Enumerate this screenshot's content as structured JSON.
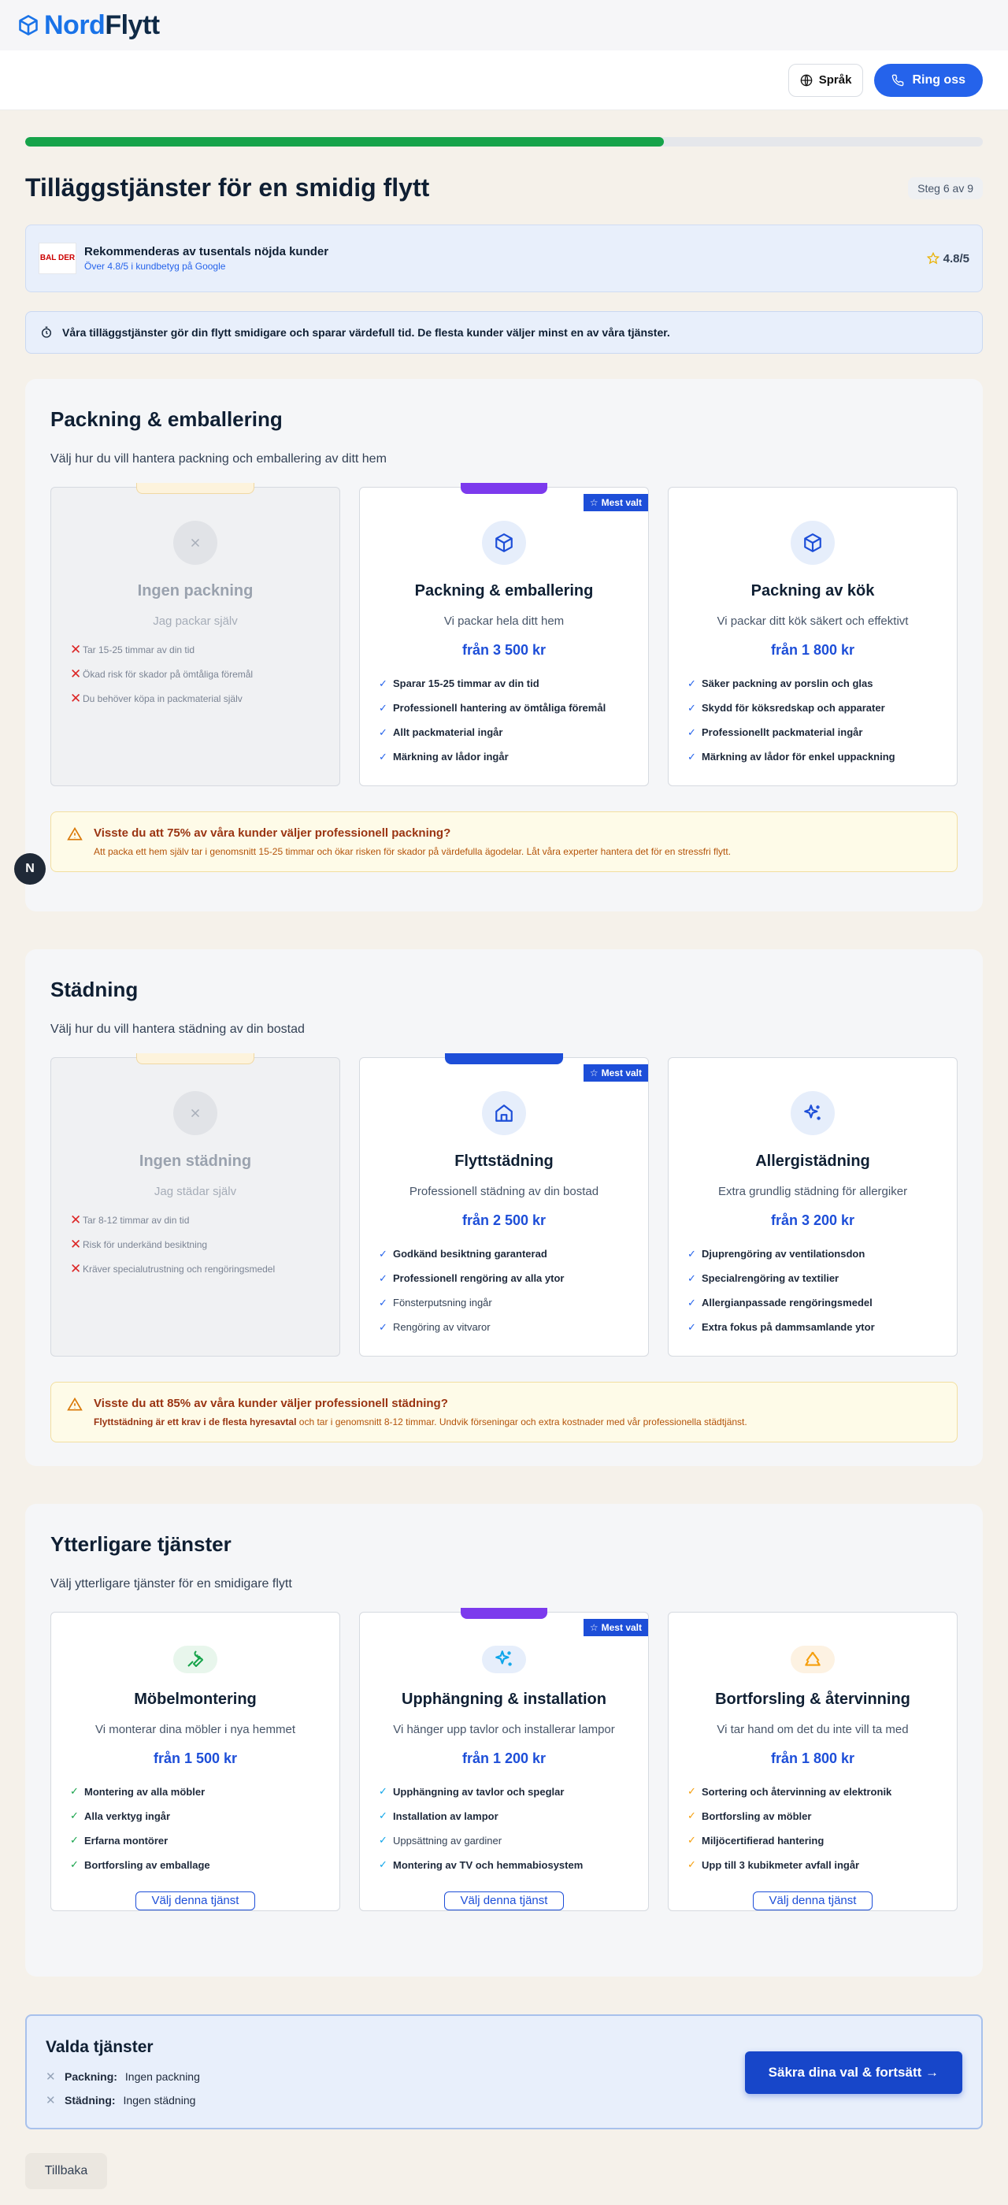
{
  "brand": {
    "nord": "Nord",
    "flytt": "Flytt"
  },
  "header": {
    "language_label": "Språk",
    "call_label": "Ring oss"
  },
  "progress": {
    "fraction": 0.667
  },
  "page": {
    "title": "Tilläggstjänster för en smidig flytt",
    "step": "Steg 6 av 9"
  },
  "recommend": {
    "logo_text": "BAL DER",
    "title": "Rekommenderas av tusentals nöjda kunder",
    "subtitle": "Över 4.8/5 i kundbetyg på Google",
    "rating": "4.8/5"
  },
  "info_text": "Våra tilläggstjänster gör din flytt smidigare och sparar värdefull tid. De flesta kunder väljer minst en av våra tjänster.",
  "mest_label": "Mest valt",
  "packing": {
    "title": "Packning & emballering",
    "subtitle": "Välj hur du vill hantera packning och emballering av ditt hem",
    "none": {
      "title": "Ingen packning",
      "desc": "Jag packar själv",
      "cons": [
        "Tar 15-25 timmar av din tid",
        "Ökad risk för skador på ömtåliga föremål",
        "Du behöver köpa in packmaterial själv"
      ]
    },
    "full": {
      "title": "Packning & emballering",
      "desc": "Vi packar hela ditt hem",
      "price": "från 3 500 kr",
      "features": [
        "Sparar 15-25 timmar av din tid",
        "Professionell hantering av ömtåliga föremål",
        "Allt packmaterial ingår",
        "Märkning av lådor ingår"
      ]
    },
    "kitchen": {
      "title": "Packning av kök",
      "desc": "Vi packar ditt kök säkert och effektivt",
      "price": "från 1 800 kr",
      "features": [
        "Säker packning av porslin och glas",
        "Skydd för köksredskap och apparater",
        "Professionellt packmaterial ingår",
        "Märkning av lådor för enkel uppackning"
      ]
    },
    "tip_title": "Visste du att 75% av våra kunder väljer professionell packning?",
    "tip_text": "Att packa ett hem själv tar i genomsnitt 15-25 timmar och ökar risken för skador på värdefulla ägodelar. Låt våra experter hantera det för en stressfri flytt."
  },
  "cleaning": {
    "title": "Städning",
    "subtitle": "Välj hur du vill hantera städning av din bostad",
    "none": {
      "title": "Ingen städning",
      "desc": "Jag städar själv",
      "cons": [
        "Tar 8-12 timmar av din tid",
        "Risk för underkänd besiktning",
        "Kräver specialutrustning och rengöringsmedel"
      ]
    },
    "move": {
      "title": "Flyttstädning",
      "desc": "Professionell städning av din bostad",
      "price": "från 2 500 kr",
      "features": [
        "Godkänd besiktning garanterad",
        "Professionell rengöring av alla ytor",
        "Fönsterputsning ingår",
        "Rengöring av vitvaror"
      ]
    },
    "allergy": {
      "title": "Allergistädning",
      "desc": "Extra grundlig städning för allergiker",
      "price": "från 3 200 kr",
      "features": [
        "Djuprengöring av ventilationsdon",
        "Specialrengöring av textilier",
        "Allergianpassade rengöringsmedel",
        "Extra fokus på dammsamlande ytor"
      ]
    },
    "tip_title": "Visste du att 85% av våra kunder väljer professionell städning?",
    "tip_bold": "Flyttstädning är ett krav i de flesta hyresavtal",
    "tip_text": " och tar i genomsnitt 8-12 timmar. Undvik förseningar och extra kostnader med vår professionella städtjänst."
  },
  "extra": {
    "title": "Ytterligare tjänster",
    "subtitle": "Välj ytterligare tjänster för en smidigare flytt",
    "choose_label": "Välj denna tjänst",
    "furniture": {
      "title": "Möbelmontering",
      "desc": "Vi monterar dina möbler i nya hemmet",
      "price": "från 1 500 kr",
      "features": [
        "Montering av alla möbler",
        "Alla verktyg ingår",
        "Erfarna montörer",
        "Bortforsling av emballage"
      ]
    },
    "install": {
      "title": "Upphängning & installation",
      "desc": "Vi hänger upp tavlor och installerar lampor",
      "price": "från 1 200 kr",
      "features": [
        "Upphängning av tavlor och speglar",
        "Installation av lampor",
        "Uppsättning av gardiner",
        "Montering av TV och hemmabiosystem"
      ]
    },
    "removal": {
      "title": "Bortforsling & återvinning",
      "desc": "Vi tar hand om det du inte vill ta med",
      "price": "från 1 800 kr",
      "features": [
        "Sortering och återvinning av elektronik",
        "Bortforsling av möbler",
        "Miljöcertifierad hantering",
        "Upp till 3 kubikmeter avfall ingår"
      ]
    }
  },
  "selected": {
    "title": "Valda tjänster",
    "rows": [
      {
        "label": "Packning:",
        "value": "Ingen packning"
      },
      {
        "label": "Städning:",
        "value": "Ingen städning"
      }
    ],
    "cta": "Säkra dina val & fortsätt →"
  },
  "back_label": "Tillbaka",
  "fab_letter": "N",
  "colors": {
    "accent": "#1d4ed8",
    "progress": "#16a34a",
    "call": "#2563eb"
  }
}
